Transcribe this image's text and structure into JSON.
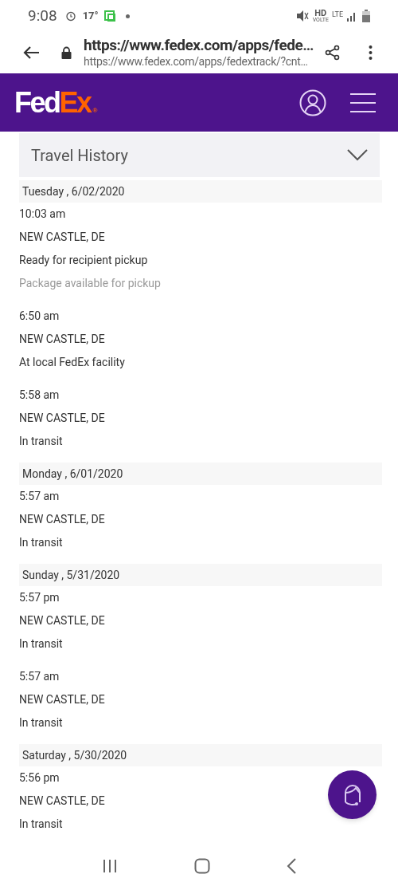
{
  "status_bar": {
    "time": "9:08",
    "temperature": "17°",
    "network": "HD",
    "network_sub": "VOLTE",
    "lte": "LTE"
  },
  "browser": {
    "title": "https://www.fedex.com/apps/fede…",
    "url": "https://www.fedex.com/apps/fedextrack/?cnt…"
  },
  "header": {
    "logo_fed": "Fed",
    "logo_ex": "Ex",
    "logo_mark": "®"
  },
  "travel_history": {
    "title": "Travel History",
    "expanded": true,
    "days": [
      {
        "date": "Tuesday , 6/02/2020",
        "events": [
          {
            "time": "10:03 am",
            "location": "NEW CASTLE, DE",
            "status": "Ready for recipient pickup",
            "detail": "Package available for pickup"
          },
          {
            "time": "6:50 am",
            "location": "NEW CASTLE, DE",
            "status": "At local FedEx facility"
          },
          {
            "time": "5:58 am",
            "location": "NEW CASTLE, DE",
            "status": "In transit"
          }
        ]
      },
      {
        "date": "Monday , 6/01/2020",
        "events": [
          {
            "time": "5:57 am",
            "location": "NEW CASTLE, DE",
            "status": "In transit"
          }
        ]
      },
      {
        "date": "Sunday , 5/31/2020",
        "events": [
          {
            "time": "5:57 pm",
            "location": "NEW CASTLE, DE",
            "status": "In transit"
          },
          {
            "time": "5:57 am",
            "location": "NEW CASTLE, DE",
            "status": "In transit"
          }
        ]
      },
      {
        "date": "Saturday , 5/30/2020",
        "events": [
          {
            "time": "5:56 pm",
            "location": "NEW CASTLE, DE",
            "status": "In transit"
          }
        ]
      }
    ]
  }
}
